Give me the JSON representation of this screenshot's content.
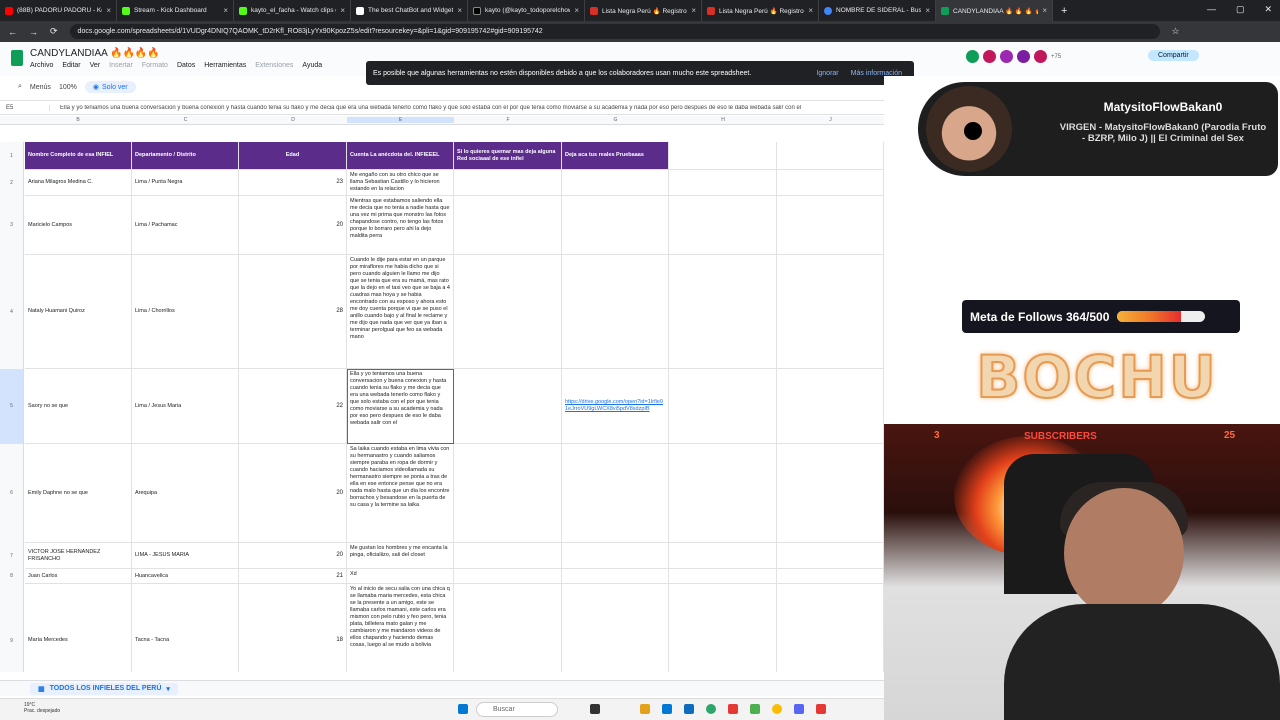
{
  "browser": {
    "tabs": [
      {
        "title": "(88B) PADORU PADORU - Ken2",
        "color": "#ff0000"
      },
      {
        "title": "Stream - Kick Dashboard",
        "color": "#53fc18"
      },
      {
        "title": "kayto_el_facha - Watch clips on",
        "color": "#53fc18"
      },
      {
        "title": "The best ChatBot and Widget",
        "color": "#ffffff"
      },
      {
        "title": "kayto (@kayto_todoporelchow",
        "color": "#000000"
      },
      {
        "title": "Lista Negra Perú 🔥 Registro N",
        "color": "#d93025"
      },
      {
        "title": "Lista Negra Perú 🔥 Registro N",
        "color": "#d93025"
      },
      {
        "title": "NOMBRE DE SIDERAL - Buscar",
        "color": "#4285f4"
      },
      {
        "title": "CANDYLANDIAA 🔥 🔥 🔥 🔥",
        "color": "#0f9d58"
      }
    ],
    "close_glyph": "×",
    "new_tab": "+",
    "url": "docs.google.com/spreadsheets/d/1VUDgr4DNIQ7QAOMK_tD2rKfl_RO83jLyYx90KpozZ5s/edit?resourcekey=&pli=1&gid=909195742#gid=909195742",
    "win_min": "—",
    "win_max": "▢",
    "win_close": "✕"
  },
  "sheets": {
    "title": "CANDYLANDIAA 🔥🔥🔥🔥",
    "menus": [
      "Archivo",
      "Editar",
      "Ver",
      "Insertar",
      "Formato",
      "Datos",
      "Herramientas",
      "Extensiones",
      "Ayuda"
    ],
    "menus_dim": [
      false,
      false,
      false,
      true,
      true,
      false,
      false,
      true,
      false
    ],
    "banner_text": "Es posible que algunas herramientas no estén disponibles debido a que los colaboradores usan mucho este spreadsheet.",
    "banner_ignore": "Ignorar",
    "banner_more": "Más información",
    "menus_label": "Menús",
    "zoom": "100%",
    "view_only": "Solo ver",
    "share": "Compartir",
    "extra_users": "+75",
    "cell_ref": "E5",
    "formula": "Ella y yo teniamos una buena conversacion y buena conexion y hasta cuando tenia su flako y me decia que era una webada tenerlo como flako y que solo estaba con el por que tenia como moviarse a su academia y nada por eso pero despues de eso le daba webada salir con el",
    "columns": [
      "B",
      "C",
      "D",
      "E",
      "F",
      "G",
      "H",
      "J",
      "K"
    ],
    "headers": [
      "Nombre Completo de esa INFIEL",
      "Departamento / Distrito",
      "Edad",
      "Cuenta La anécdota del. INFIEEEL",
      "Si lo quieres quemar mas deja alguna Red sociaaal de ese infiel",
      "Deja aca tus reales Pruebaaas"
    ],
    "row_numbers": [
      "1",
      "2",
      "3",
      "4",
      "5",
      "6",
      "7",
      "8",
      "9"
    ],
    "rows": [
      {
        "name": "Ariana Milagros Medina C.",
        "place": "Lima / Punta Negra",
        "age": "23",
        "story": "Me engaño con su otro chico que se llama Sebastian Castillo y lo hicieron estando en la relacion",
        "social": "",
        "proof": ""
      },
      {
        "name": "Maricielo Campos",
        "place": "Lima / Pachamac",
        "age": "20",
        "story": "Mientras que estabamos saliendo ella me decia que no tenia a nadie hasta que una vez mi prima que monstro las fotos chapandose contro, no tengo las fotos porque lo borraro pero ahi la dejo maldita perra",
        "social": "",
        "proof": ""
      },
      {
        "name": "Nataly Huamani Quiroz",
        "place": "Lima / Chorrillos",
        "age": "28",
        "story": "Cuando le dije para estar en un parque por miraflores me habia dicho que si pero cuando alguien le llamo me dijo que se tenia que era su mamá, mas rato que la dejo en el taxi veo que se baja a 4 cuadras mas hoya y se habia encontrado con su esposo y ahora esto me doy cuenta porque vi que se puso el anillo cuando bajo y al final le reclame y me dijo que nada que ver que ya iban a terminar perolgual que feo sa webada mano",
        "social": "",
        "proof": ""
      },
      {
        "name": "Saory no se que",
        "place": "Lima / Jesus Maria",
        "age": "22",
        "story": "Ella y yo teniamos una buena conversacion y buena conexion y hasta cuando tenia su flako y me decia que era una webada tenerlo como flako y que solo estaba con el por que tenia como moviarse a su academia y nada por eso pero despues de eso le daba webada salir con el",
        "social": "",
        "proof": "https://drive.google.com/open?id=1Irfie01eJrroVU9gLWCX8vi5pdV8sdzpIB"
      },
      {
        "name": "Emily Daphne no se que",
        "place": "Arequipa",
        "age": "20",
        "story": "Sa laika cuando estaba en lima vivia con su hermanastro y cuando saliamos siempre paraba en ropa de dormir y cuando haciamos videollamada su hermanastro siempre se ponia a tras de ella en ese entonce pense que no era nada malo hasta que un dia los encontre borrachos y besandose en la puerta de su casa y la termine sa laika",
        "social": "",
        "proof": ""
      },
      {
        "name": "VICTOR JOSE HERNANDEZ FRISANCHO",
        "place": "LIMA - JESUS MARIA",
        "age": "20",
        "story": "Me gustan los hombres y me encanta la pinga, oficialiizo, sali del closet",
        "social": "",
        "proof": ""
      },
      {
        "name": "Juan Carlos",
        "place": "Huancavelica",
        "age": "21",
        "story": "Xd",
        "social": "",
        "proof": ""
      },
      {
        "name": "María Mercedes",
        "place": "Tacna - Tacna",
        "age": "18",
        "story": "Yo al inicio de secu salia con una chica q se llamaba maria mercedes, esta chica se la presente a un amigo, este se llamaba carlos mamani, este carlos era mismon con pelo rubio y feo pero, tenia plata, billetera mato galan y me cambiaron y me mandaron videos de ellos chapando y haciendo demas cosas, luego al se mudo a bolivia",
        "social": "",
        "proof": ""
      }
    ],
    "sheet_tab": "TODOS LOS INFIELES DEL PERÚ",
    "sheet_tab_arrow": "▾"
  },
  "taskbar": {
    "temp": "19°C",
    "weather": "Prac. despejado",
    "search": "Buscar"
  },
  "stream": {
    "profile_name": "MatysitoFlowBakan0",
    "profile_song": "VIRGEN - MatysitoFlowBakan0 (Parodia Fruto - BZRP, Milo J) || El Criminal del Sex",
    "goal_label": "Meta de Follows 364/500",
    "goal_current": 364,
    "goal_target": 500,
    "logo_text": "BOCHU",
    "subs_label": "SUBSCRIBERS",
    "subs_left": "3",
    "subs_right": "25"
  },
  "icons": {
    "back": "←",
    "forward": "→",
    "reload": "⟳",
    "star": "☆",
    "search": "⌕",
    "grid": "▦"
  }
}
